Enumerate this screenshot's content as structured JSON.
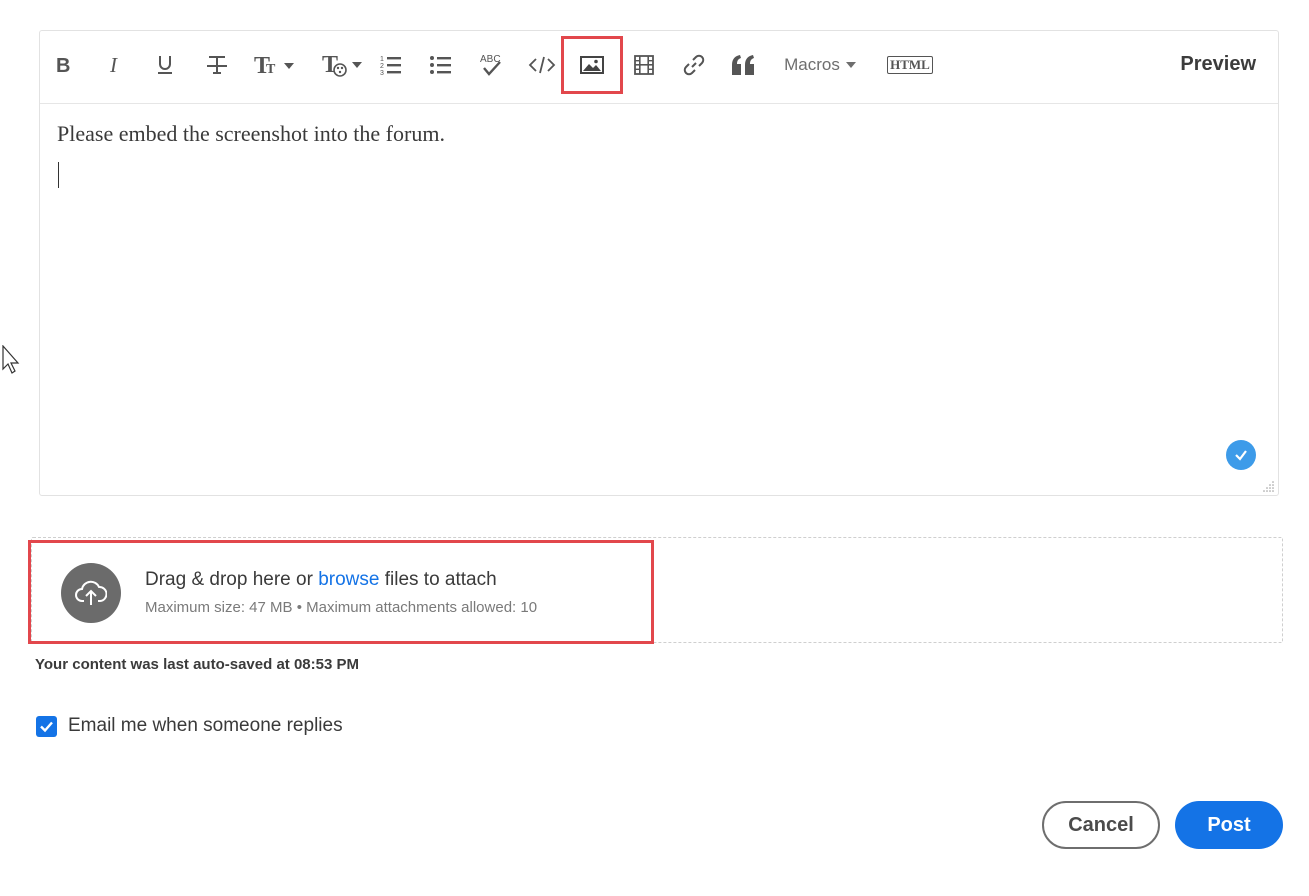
{
  "toolbar": {
    "buttons": [
      "bold-icon",
      "italic-icon",
      "underline-icon",
      "strikethrough-icon",
      "font-size-icon",
      "text-color-icon",
      "numbered-list-icon",
      "bulleted-list-icon",
      "spellcheck-icon",
      "code-icon",
      "image-icon",
      "video-icon",
      "link-icon",
      "quote-icon"
    ],
    "macros_label": "Macros",
    "html_label": "HTML",
    "preview_label": "Preview"
  },
  "editor": {
    "content": "Please embed the screenshot into the forum."
  },
  "dropzone": {
    "text_before": "Drag & drop here or ",
    "browse_link": "browse",
    "text_after": " files to attach",
    "limits": "Maximum size: 47 MB • Maximum attachments allowed: 10"
  },
  "autosave": "Your content was last auto-saved at 08:53 PM",
  "email_option": {
    "label": "Email me when someone replies",
    "checked": true
  },
  "actions": {
    "cancel_label": "Cancel",
    "post_label": "Post"
  },
  "colors": {
    "accent": "#1473e6",
    "highlight": "#e2474c",
    "check_badge": "#3d9be9"
  }
}
